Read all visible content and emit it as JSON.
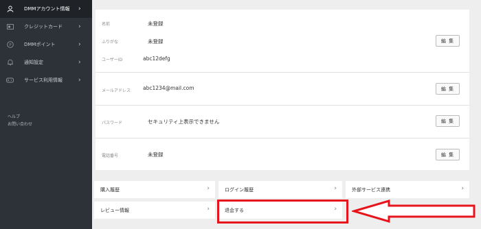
{
  "sidebar": {
    "items": [
      {
        "label": "DMMアカウント情報",
        "icon": "user-icon",
        "active": true
      },
      {
        "label": "クレジットカード",
        "icon": "credit-card-icon",
        "active": false
      },
      {
        "label": "DMMポイント",
        "icon": "point-coin-icon",
        "active": false
      },
      {
        "label": "通知設定",
        "icon": "bell-icon",
        "active": false
      },
      {
        "label": "サービス利用情報",
        "icon": "gamepad-icon",
        "active": false
      }
    ],
    "help_label": "ヘルプ",
    "contact_label": "お問い合わせ"
  },
  "profile": {
    "name_label": "名前",
    "name_value": "未登録",
    "kana_label": "ふりがな",
    "kana_value": "未登録",
    "userid_label": "ユーザーID",
    "userid_value": "abc12defg",
    "email_label": "メールアドレス",
    "email_value": "abc1234@mail.com",
    "password_label": "パスワード",
    "password_value": "セキュリティ上表示できません",
    "phone_label": "電話番号",
    "phone_value": "未登録",
    "edit_label": "編 集"
  },
  "links": {
    "purchase_history": "購入履歴",
    "login_history": "ログイン履歴",
    "external_services": "外部サービス連携",
    "review_info": "レビュー情報",
    "withdraw": "退会する"
  },
  "colors": {
    "sidebar_bg": "#2d3138",
    "sidebar_active_bg": "#1f2227",
    "highlight": "#e8141c",
    "page_bg": "#eeeeee"
  }
}
